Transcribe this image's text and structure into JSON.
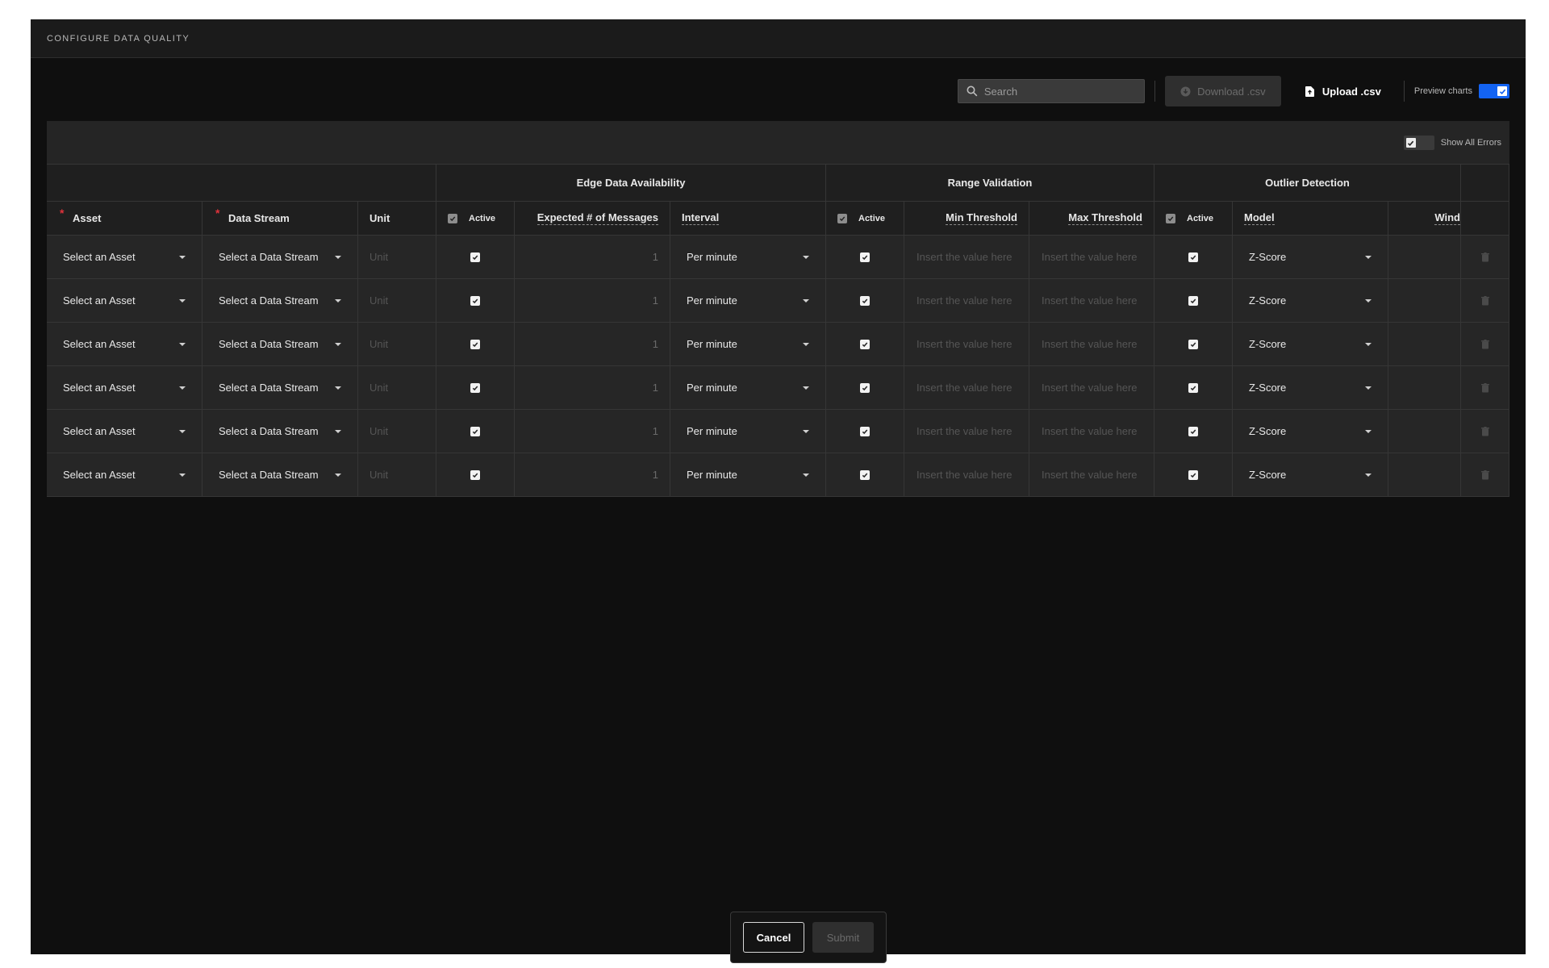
{
  "modal": {
    "title": "CONFIGURE DATA QUALITY"
  },
  "toolbar": {
    "search_placeholder": "Search",
    "download_label": "Download .csv",
    "upload_label": "Upload .csv",
    "preview_label": "Preview charts",
    "preview_on": true
  },
  "table_top": {
    "show_errors_label": "Show All Errors"
  },
  "groups": {
    "edge": "Edge Data Availability",
    "range": "Range Validation",
    "outlier": "Outlier Detection"
  },
  "headers": {
    "asset": "Asset",
    "data_stream": "Data Stream",
    "unit": "Unit",
    "active": "Active",
    "expected": "Expected # of Messages",
    "interval": "Interval",
    "min": "Min Threshold",
    "max": "Max Threshold",
    "model": "Model",
    "window": "Wind"
  },
  "rows": [
    {
      "asset": "Select an Asset",
      "stream": "Select a Data Stream",
      "unit": "Unit",
      "expected": "1",
      "interval": "Per minute",
      "min": "Insert the value here",
      "max": "Insert the value here",
      "model": "Z-Score"
    },
    {
      "asset": "Select an Asset",
      "stream": "Select a Data Stream",
      "unit": "Unit",
      "expected": "1",
      "interval": "Per minute",
      "min": "Insert the value here",
      "max": "Insert the value here",
      "model": "Z-Score"
    },
    {
      "asset": "Select an Asset",
      "stream": "Select a Data Stream",
      "unit": "Unit",
      "expected": "1",
      "interval": "Per minute",
      "min": "Insert the value here",
      "max": "Insert the value here",
      "model": "Z-Score"
    },
    {
      "asset": "Select an Asset",
      "stream": "Select a Data Stream",
      "unit": "Unit",
      "expected": "1",
      "interval": "Per minute",
      "min": "Insert the value here",
      "max": "Insert the value here",
      "model": "Z-Score"
    },
    {
      "asset": "Select an Asset",
      "stream": "Select a Data Stream",
      "unit": "Unit",
      "expected": "1",
      "interval": "Per minute",
      "min": "Insert the value here",
      "max": "Insert the value here",
      "model": "Z-Score"
    },
    {
      "asset": "Select an Asset",
      "stream": "Select a Data Stream",
      "unit": "Unit",
      "expected": "1",
      "interval": "Per minute",
      "min": "Insert the value here",
      "max": "Insert the value here",
      "model": "Z-Score"
    }
  ],
  "footer": {
    "cancel_label": "Cancel",
    "submit_label": "Submit"
  },
  "colors": {
    "accent": "#1363f2",
    "required": "#e0323b",
    "background": "#0f0f0f"
  }
}
